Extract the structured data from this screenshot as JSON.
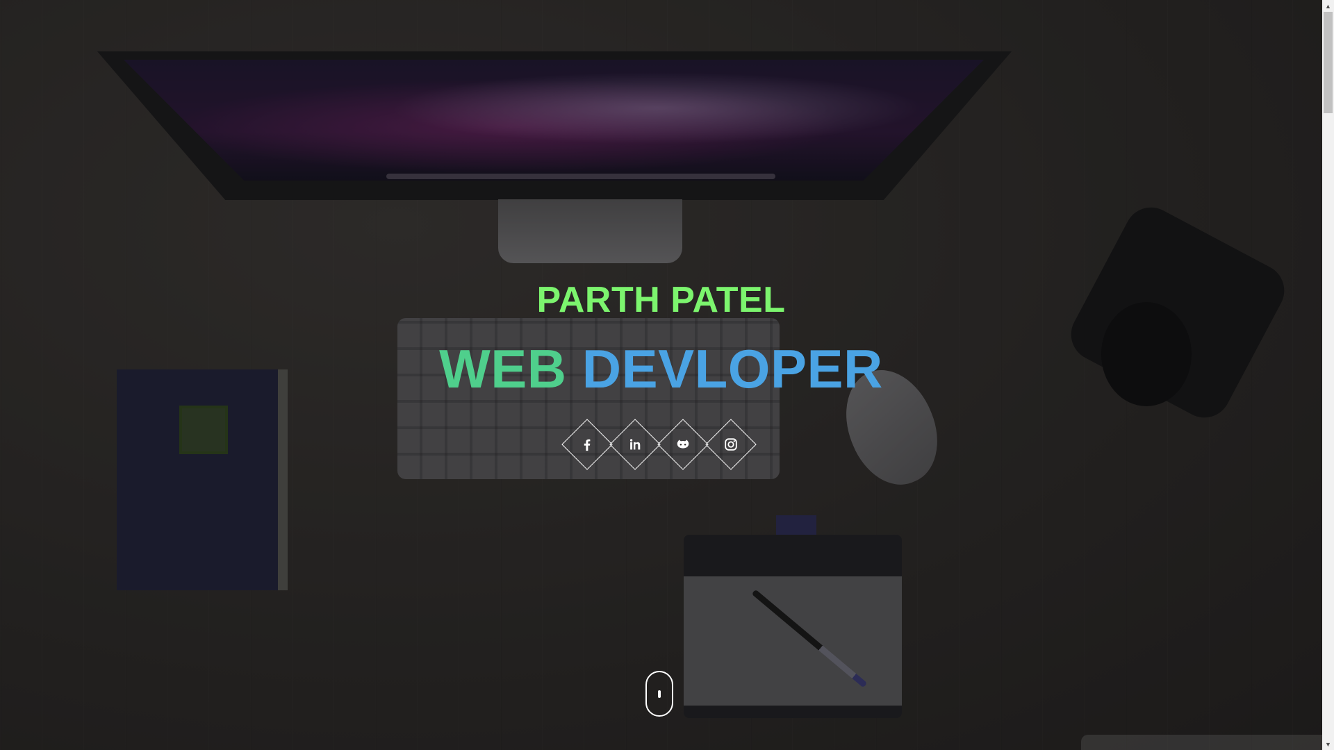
{
  "hero": {
    "name": "PARTH PATEL",
    "title_part1": "WEB",
    "title_part2": "DEVLOPER"
  },
  "social_links": [
    {
      "name": "facebook",
      "icon": "facebook-icon"
    },
    {
      "name": "linkedin",
      "icon": "linkedin-icon"
    },
    {
      "name": "github",
      "icon": "github-icon"
    },
    {
      "name": "instagram",
      "icon": "instagram-icon"
    }
  ],
  "scroll_indicator": {
    "icon": "mouse-scroll-icon"
  },
  "scrollbar": {
    "up_arrow": "▲",
    "down_arrow": "▼"
  },
  "colors": {
    "name": "#7cf56e",
    "title_word1": "#4fcf8c",
    "title_word2": "#4aa3e4",
    "icon_border": "#ffffff",
    "overlay": "rgba(0,0,0,0.4)"
  }
}
